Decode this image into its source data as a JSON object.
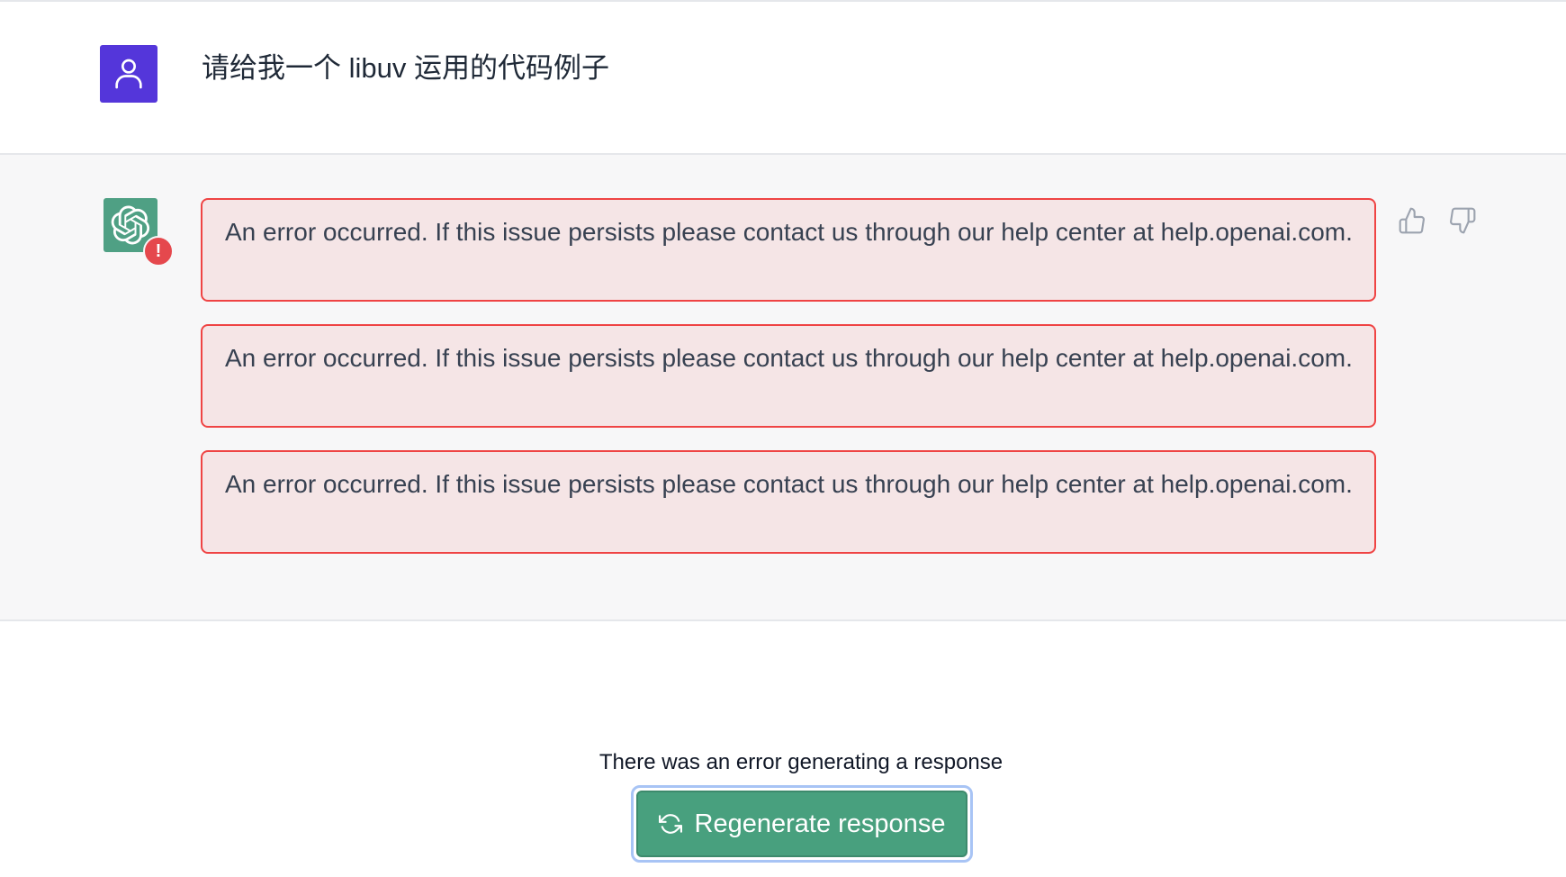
{
  "user_message": {
    "text": "请给我一个 libuv 运用的代码例子"
  },
  "assistant_message": {
    "error_badge": "!",
    "errors": [
      "An error occurred. If this issue persists please contact us through our help center at help.openai.com.",
      "An error occurred. If this issue persists please contact us through our help center at help.openai.com.",
      "An error occurred. If this issue persists please contact us through our help center at help.openai.com."
    ]
  },
  "footer": {
    "error_text": "There was an error generating a response",
    "regenerate_label": "Regenerate response"
  },
  "colors": {
    "user_avatar": "#5436da",
    "bot_avatar": "#4fa084",
    "error_border": "#ef4444",
    "error_bg": "#f5e5e6",
    "regenerate_button": "#48a07e"
  }
}
